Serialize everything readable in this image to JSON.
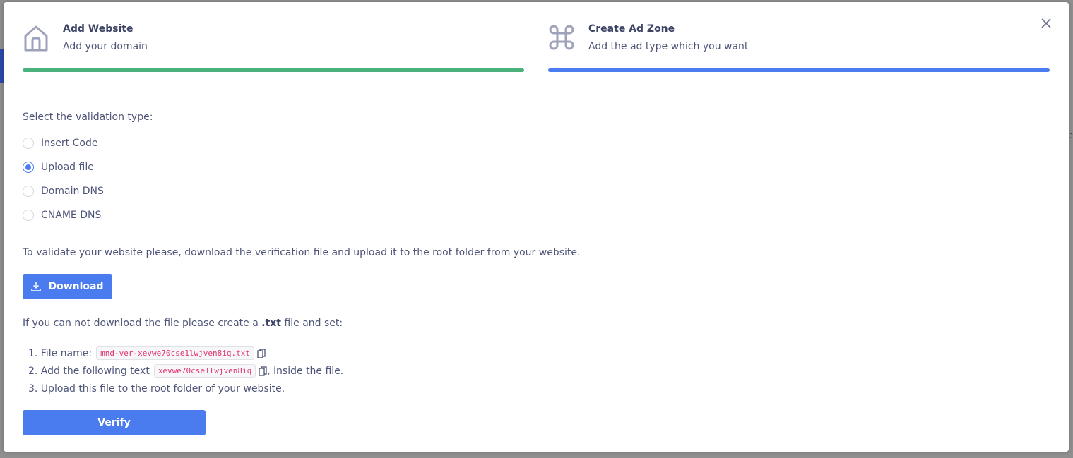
{
  "backdrop": {
    "partial_text": "re"
  },
  "steps": [
    {
      "title": "Add Website",
      "subtitle": "Add your domain",
      "icon": "home-icon",
      "bar_color": "#48b27a"
    },
    {
      "title": "Create Ad Zone",
      "subtitle": "Add the ad type which you want",
      "icon": "command-icon",
      "bar_color": "#4a7bef"
    }
  ],
  "validation": {
    "label": "Select the validation type:",
    "options": [
      {
        "label": "Insert Code",
        "checked": false
      },
      {
        "label": "Upload file",
        "checked": true
      },
      {
        "label": "Domain DNS",
        "checked": false
      },
      {
        "label": "CNAME DNS",
        "checked": false
      }
    ]
  },
  "instructions": "To validate your website please, download the verification file and upload it to the root folder from your website.",
  "download_label": "Download",
  "fallback": {
    "prefix": "If you can not download the file please create a ",
    "ext": ".txt",
    "suffix": " file and set:"
  },
  "list": {
    "item1_prefix": "1. File name:",
    "file_name": "mnd-ver-xevwe70cse1lwjven8iq.txt",
    "item2_prefix": "2. Add the following text",
    "token": "xevwe70cse1lwjven8iq",
    "item2_suffix": ", inside the file.",
    "item3": "3. Upload this file to the root folder of your website."
  },
  "verify_label": "Verify",
  "colors": {
    "accent": "#4a7bef",
    "success": "#48b27a",
    "code": "#e0356e"
  }
}
